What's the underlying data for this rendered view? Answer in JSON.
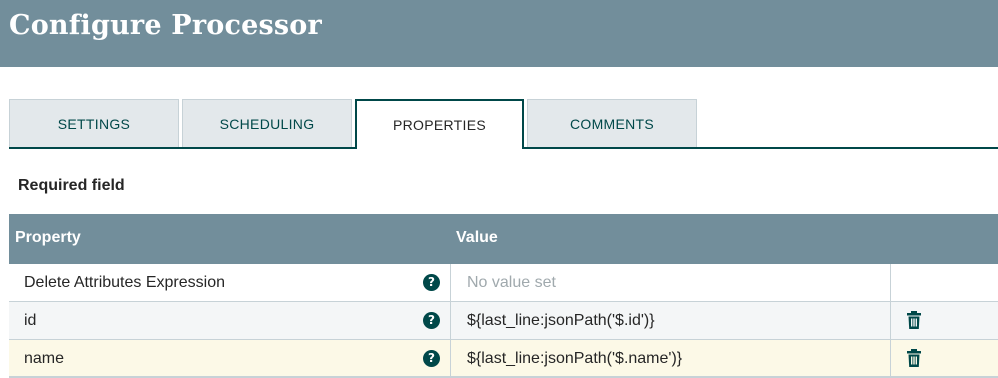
{
  "dialog": {
    "title": "Configure Processor"
  },
  "tabs": [
    {
      "label": "SETTINGS",
      "active": false
    },
    {
      "label": "SCHEDULING",
      "active": false
    },
    {
      "label": "PROPERTIES",
      "active": true
    },
    {
      "label": "COMMENTS",
      "active": false
    }
  ],
  "properties": {
    "required_label": "Required field",
    "columns": {
      "property": "Property",
      "value": "Value"
    },
    "rows": [
      {
        "name": "Delete Attributes Expression",
        "value": "No value set",
        "has_value": false,
        "help_icon": "question-circle-icon",
        "delete_icon": null
      },
      {
        "name": "id",
        "value": "${last_line:jsonPath('$.id')}",
        "has_value": true,
        "help_icon": "question-circle-icon",
        "delete_icon": "trash-icon"
      },
      {
        "name": "name",
        "value": "${last_line:jsonPath('$.name')}",
        "has_value": true,
        "help_icon": "question-circle-icon",
        "delete_icon": "trash-icon"
      }
    ]
  },
  "colors": {
    "header_bg": "#728e9b",
    "accent": "#004849",
    "row_highlight": "#fcf9e7",
    "placeholder_text": "#a0a9ad"
  }
}
